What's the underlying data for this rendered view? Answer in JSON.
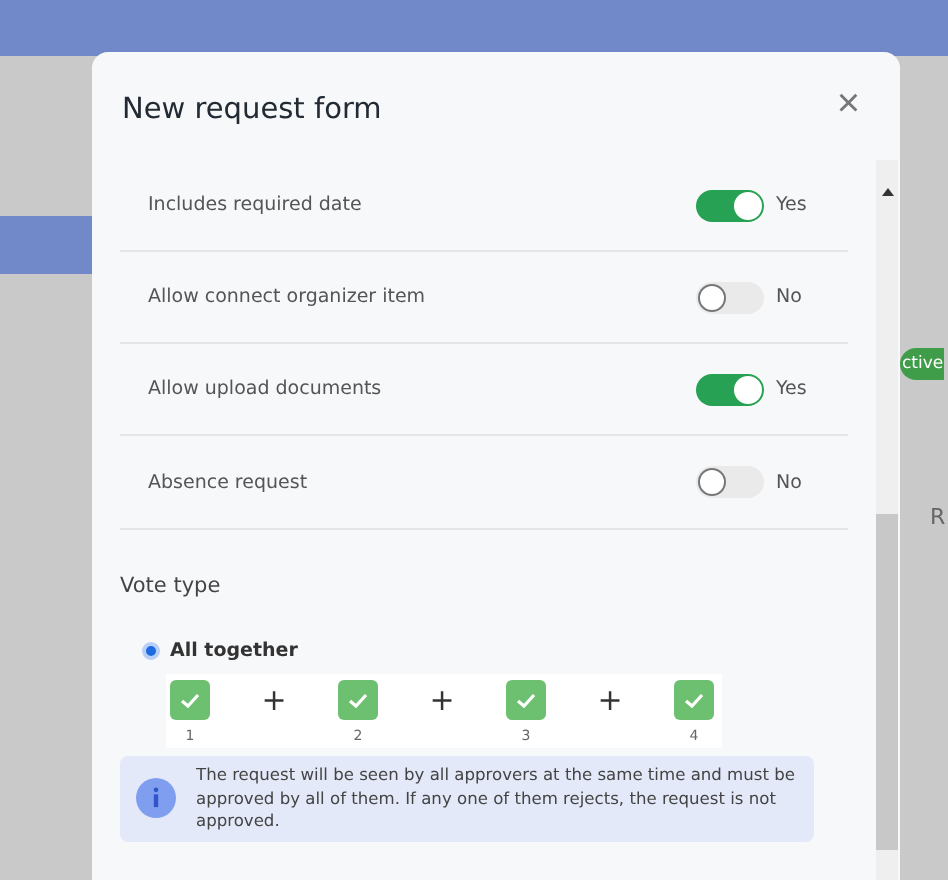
{
  "background": {
    "badge": "ctive",
    "cell_text": "R"
  },
  "dialog": {
    "title": "New request form",
    "close": "×",
    "settings": [
      {
        "label": "Includes required date",
        "on": true,
        "state_text": "Yes"
      },
      {
        "label": "Allow connect organizer item",
        "on": false,
        "state_text": "No"
      },
      {
        "label": "Allow upload documents",
        "on": true,
        "state_text": "Yes"
      },
      {
        "label": "Absence request",
        "on": false,
        "state_text": "No"
      }
    ],
    "vote_type": {
      "heading": "Vote type",
      "options": [
        {
          "label": "All together",
          "selected": true
        }
      ],
      "approvers": [
        {
          "number": "1"
        },
        {
          "number": "2"
        },
        {
          "number": "3"
        },
        {
          "number": "4"
        }
      ],
      "joiner": "+",
      "info": "The request will be seen by all approvers at the same time and must be approved by all of them. If any one of them rejects, the request is not approved."
    }
  }
}
